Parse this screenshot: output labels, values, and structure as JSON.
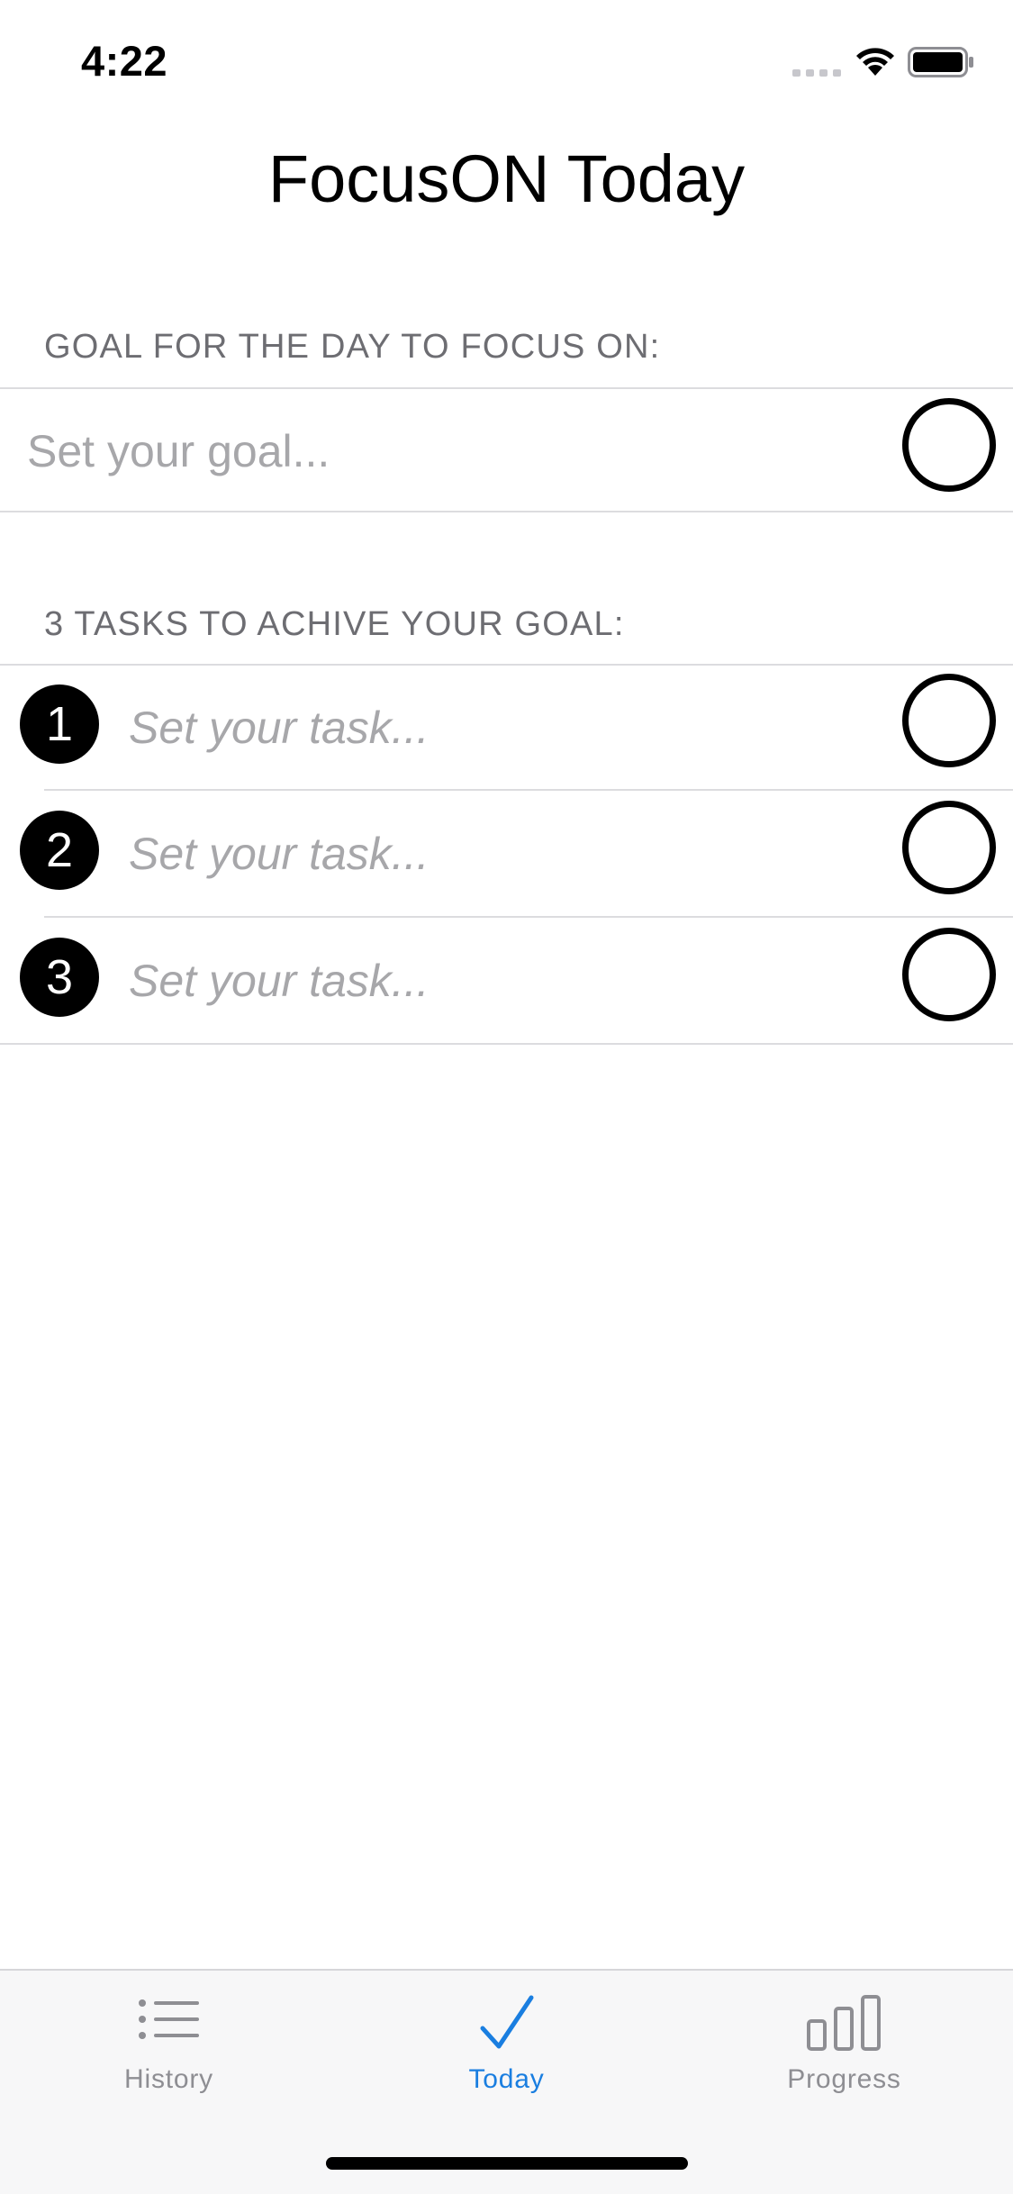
{
  "status_bar": {
    "time": "4:22",
    "icons": [
      "cellular-signal-icon",
      "wifi-icon",
      "battery-icon"
    ]
  },
  "header": {
    "title": "FocusON Today"
  },
  "goal_section": {
    "header": "GOAL FOR THE DAY TO FOCUS ON:",
    "placeholder": "Set your goal...",
    "value": "",
    "completed": false
  },
  "tasks_section": {
    "header": "3 TASKS TO ACHIVE YOUR GOAL:",
    "tasks": [
      {
        "number": "1",
        "placeholder": "Set your task...",
        "value": "",
        "completed": false
      },
      {
        "number": "2",
        "placeholder": "Set your task...",
        "value": "",
        "completed": false
      },
      {
        "number": "3",
        "placeholder": "Set your task...",
        "value": "",
        "completed": false
      }
    ]
  },
  "tab_bar": {
    "tabs": [
      {
        "label": "History",
        "icon": "list-icon",
        "active": false
      },
      {
        "label": "Today",
        "icon": "checkmark-icon",
        "active": true
      },
      {
        "label": "Progress",
        "icon": "bar-chart-icon",
        "active": false
      }
    ]
  },
  "colors": {
    "accent": "#1a7ee0",
    "inactive_tab": "#8e8e93",
    "section_header": "#6d6d72",
    "placeholder": "#a7a7aa",
    "separator": "#dcdcdf"
  }
}
